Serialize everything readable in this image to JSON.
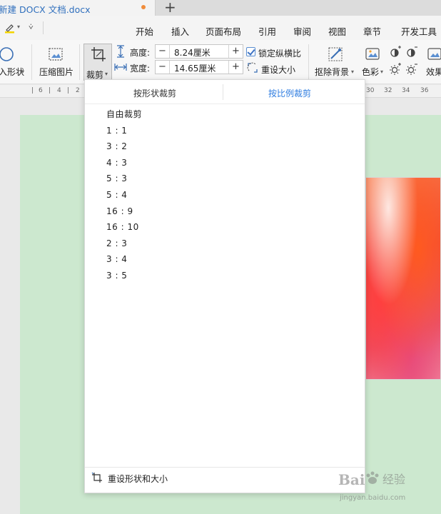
{
  "window": {
    "doc_tab_title": "新建 DOCX 文档.docx",
    "new_tab_symbol": "+"
  },
  "menubar": {
    "quick_more": "⩒",
    "items": [
      "开始",
      "插入",
      "页面布局",
      "引用",
      "审阅",
      "视图",
      "章节",
      "开发工具"
    ]
  },
  "ribbon": {
    "shape_label": "入形状",
    "compress_label": "压缩图片",
    "crop_label": "裁剪",
    "height_label": "高度:",
    "height_value": "8.24厘米",
    "width_label": "宽度:",
    "width_value": "14.65厘米",
    "lock_ratio_label": "锁定纵横比",
    "lock_ratio_checked": true,
    "reset_size_label": "重设大小",
    "remove_bg_label": "抠除背景",
    "color_label": "色彩",
    "effect_label": "效果",
    "minus": "−",
    "plus": "+"
  },
  "ruler": {
    "ticks": [
      "6",
      "4",
      "2",
      "30",
      "32",
      "34",
      "36"
    ]
  },
  "crop_dropdown": {
    "tabs": [
      "按形状裁剪",
      "按比例裁剪"
    ],
    "active_tab": "按比例裁剪",
    "options": [
      "自由裁剪",
      "1 : 1",
      "3 : 2",
      "4 : 3",
      "5 : 3",
      "5 : 4",
      "16 : 9",
      "16 : 10",
      "2 : 3",
      "3 : 4",
      "3 : 5"
    ],
    "footer_label": "重设形状和大小"
  },
  "watermark": {
    "text": "Bai",
    "text2": "经验",
    "url": "jingyan.baidu.com"
  },
  "colors": {
    "accent": "#2f7de0",
    "modified_dot": "#f08c3a",
    "page_bg": "#cce8cf"
  }
}
